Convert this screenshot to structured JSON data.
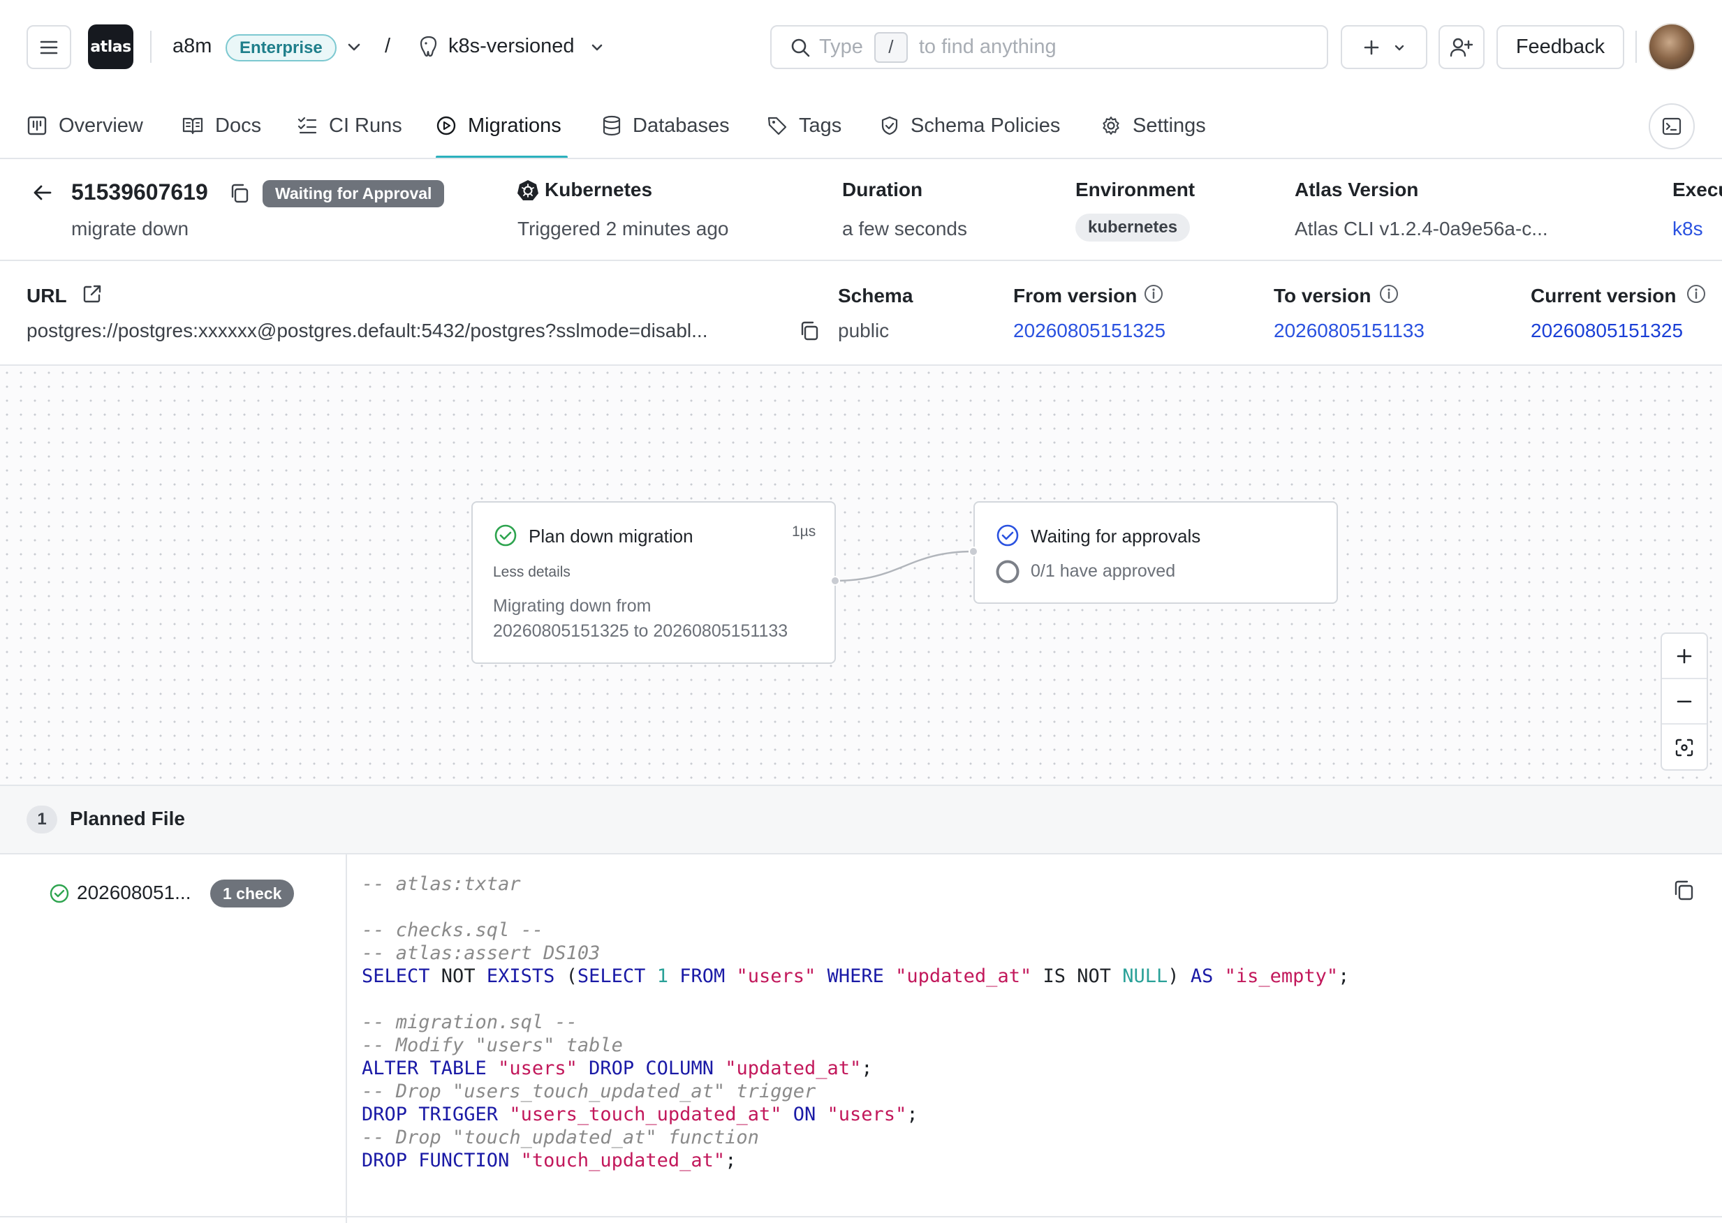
{
  "header": {
    "logo_text": "atlas",
    "org": "a8m",
    "plan_badge": "Enterprise",
    "separator": "/",
    "project": "k8s-versioned",
    "search": {
      "placeholder_left": "Type",
      "shortcut": "/",
      "placeholder_right": "to find anything"
    },
    "add_label": "+",
    "feedback_label": "Feedback"
  },
  "tabs": [
    {
      "label": "Overview",
      "icon": "overview-icon"
    },
    {
      "label": "Docs",
      "icon": "book-icon"
    },
    {
      "label": "CI Runs",
      "icon": "list-check-icon"
    },
    {
      "label": "Migrations",
      "icon": "play-circle-icon",
      "active": true
    },
    {
      "label": "Databases",
      "icon": "database-icon"
    },
    {
      "label": "Tags",
      "icon": "tag-icon"
    },
    {
      "label": "Schema Policies",
      "icon": "shield-icon"
    },
    {
      "label": "Settings",
      "icon": "gear-icon"
    }
  ],
  "summary": {
    "run_id": "51539607619",
    "status": "Waiting for Approval",
    "description": "migrate down",
    "trigger_label": "Kubernetes",
    "trigger_value": "Triggered 2 minutes ago",
    "duration_label": "Duration",
    "duration_value": "a few seconds",
    "environment_label": "Environment",
    "environment_value": "kubernetes",
    "atlas_version_label": "Atlas Version",
    "atlas_version_value": "Atlas CLI v1.2.4-0a9e56a-c...",
    "executor_label": "Execu",
    "executor_value": "k8s"
  },
  "details": {
    "url_label": "URL",
    "url_value": "postgres://postgres:xxxxxx@postgres.default:5432/postgres?sslmode=disabl...",
    "schema_label": "Schema",
    "schema_value": "public",
    "from_version_label": "From version",
    "from_version_value": "20260805151325",
    "to_version_label": "To version",
    "to_version_value": "20260805151133",
    "current_version_label": "Current version",
    "current_version_value": "20260805151325"
  },
  "flow": {
    "plan_node": {
      "title": "Plan down migration",
      "duration": "1µs",
      "toggle": "Less details",
      "text_line1": "Migrating down from",
      "text_line2": "20260805151325 to 20260805151133"
    },
    "approval_node": {
      "title": "Waiting for approvals",
      "status": "0/1 have approved"
    }
  },
  "planned": {
    "count": "1",
    "title": "Planned File",
    "file_name": "202608051...",
    "check_badge": "1 check",
    "code_lines": [
      [
        {
          "t": "-- atlas:txtar",
          "c": "com"
        }
      ],
      [],
      [
        {
          "t": "-- checks.sql --",
          "c": "com"
        }
      ],
      [
        {
          "t": "-- atlas:assert DS103",
          "c": "com"
        }
      ],
      [
        {
          "t": "SELECT",
          "c": "kw"
        },
        {
          "t": " NOT ",
          "c": "plain"
        },
        {
          "t": "EXISTS",
          "c": "kw"
        },
        {
          "t": " (",
          "c": "plain"
        },
        {
          "t": "SELECT",
          "c": "kw"
        },
        {
          "t": " ",
          "c": "plain"
        },
        {
          "t": "1",
          "c": "num"
        },
        {
          "t": " ",
          "c": "plain"
        },
        {
          "t": "FROM",
          "c": "kw"
        },
        {
          "t": " ",
          "c": "plain"
        },
        {
          "t": "\"users\"",
          "c": "str"
        },
        {
          "t": " ",
          "c": "plain"
        },
        {
          "t": "WHERE",
          "c": "kw"
        },
        {
          "t": " ",
          "c": "plain"
        },
        {
          "t": "\"updated_at\"",
          "c": "str"
        },
        {
          "t": " IS NOT ",
          "c": "plain"
        },
        {
          "t": "NULL",
          "c": "num"
        },
        {
          "t": ") ",
          "c": "plain"
        },
        {
          "t": "AS",
          "c": "kw"
        },
        {
          "t": " ",
          "c": "plain"
        },
        {
          "t": "\"is_empty\"",
          "c": "str"
        },
        {
          "t": ";",
          "c": "plain"
        }
      ],
      [],
      [
        {
          "t": "-- migration.sql --",
          "c": "com"
        }
      ],
      [
        {
          "t": "-- Modify \"users\" table",
          "c": "com"
        }
      ],
      [
        {
          "t": "ALTER TABLE",
          "c": "kw"
        },
        {
          "t": " ",
          "c": "plain"
        },
        {
          "t": "\"users\"",
          "c": "str"
        },
        {
          "t": " ",
          "c": "plain"
        },
        {
          "t": "DROP COLUMN",
          "c": "kw"
        },
        {
          "t": " ",
          "c": "plain"
        },
        {
          "t": "\"updated_at\"",
          "c": "str"
        },
        {
          "t": ";",
          "c": "plain"
        }
      ],
      [
        {
          "t": "-- Drop \"users_touch_updated_at\" trigger",
          "c": "com"
        }
      ],
      [
        {
          "t": "DROP TRIGGER",
          "c": "kw"
        },
        {
          "t": " ",
          "c": "plain"
        },
        {
          "t": "\"users_touch_updated_at\"",
          "c": "str"
        },
        {
          "t": " ",
          "c": "plain"
        },
        {
          "t": "ON",
          "c": "kw"
        },
        {
          "t": " ",
          "c": "plain"
        },
        {
          "t": "\"users\"",
          "c": "str"
        },
        {
          "t": ";",
          "c": "plain"
        }
      ],
      [
        {
          "t": "-- Drop \"touch_updated_at\" function",
          "c": "com"
        }
      ],
      [
        {
          "t": "DROP FUNCTION",
          "c": "kw"
        },
        {
          "t": " ",
          "c": "plain"
        },
        {
          "t": "\"touch_updated_at\"",
          "c": "str"
        },
        {
          "t": ";",
          "c": "plain"
        }
      ]
    ]
  },
  "colors": {
    "accent": "#2bb0bd",
    "link": "#2a52e0",
    "success": "#2ea44f",
    "pending": "#2a52e0",
    "status_pill": "#6e737b"
  }
}
